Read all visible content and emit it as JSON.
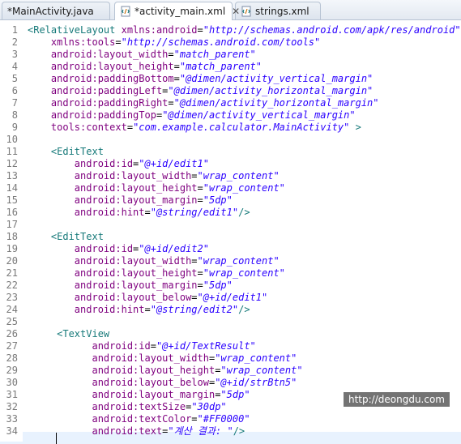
{
  "tabs": [
    {
      "label": "*MainActivity.java",
      "icon": "java-file-icon",
      "active": false
    },
    {
      "label": "*activity_main.xml",
      "icon": "xml-file-icon",
      "active": true,
      "close": "✕"
    },
    {
      "label": "strings.xml",
      "icon": "xml-file-icon",
      "active": false
    }
  ],
  "code_lines": [
    {
      "n": "1",
      "tok": [
        [
          "tag",
          "<RelativeLayout "
        ],
        [
          "attr",
          "xmlns:android"
        ],
        [
          "eq",
          "="
        ],
        [
          "val",
          "\"http://schemas.android.com/apk/res/android\""
        ]
      ]
    },
    {
      "n": "2",
      "tok": [
        [
          "attr",
          "    xmlns:tools"
        ],
        [
          "eq",
          "="
        ],
        [
          "val",
          "\"http://schemas.android.com/tools\""
        ]
      ]
    },
    {
      "n": "3",
      "tok": [
        [
          "attr",
          "    android:layout_width"
        ],
        [
          "eq",
          "="
        ],
        [
          "val",
          "\"match_parent\""
        ]
      ]
    },
    {
      "n": "4",
      "tok": [
        [
          "attr",
          "    android:layout_height"
        ],
        [
          "eq",
          "="
        ],
        [
          "val",
          "\"match_parent\""
        ]
      ]
    },
    {
      "n": "5",
      "tok": [
        [
          "attr",
          "    android:paddingBottom"
        ],
        [
          "eq",
          "="
        ],
        [
          "val",
          "\"@dimen/activity_vertical_margin\""
        ]
      ]
    },
    {
      "n": "6",
      "tok": [
        [
          "attr",
          "    android:paddingLeft"
        ],
        [
          "eq",
          "="
        ],
        [
          "val",
          "\"@dimen/activity_horizontal_margin\""
        ]
      ]
    },
    {
      "n": "7",
      "tok": [
        [
          "attr",
          "    android:paddingRight"
        ],
        [
          "eq",
          "="
        ],
        [
          "val",
          "\"@dimen/activity_horizontal_margin\""
        ]
      ]
    },
    {
      "n": "8",
      "tok": [
        [
          "attr",
          "    android:paddingTop"
        ],
        [
          "eq",
          "="
        ],
        [
          "val",
          "\"@dimen/activity_vertical_margin\""
        ]
      ]
    },
    {
      "n": "9",
      "tok": [
        [
          "attr",
          "    tools:context"
        ],
        [
          "eq",
          "="
        ],
        [
          "val",
          "\"com.example.calculator.MainActivity\""
        ],
        [
          "tag",
          " >"
        ]
      ]
    },
    {
      "n": "10",
      "tok": []
    },
    {
      "n": "11",
      "tok": [
        [
          "tag",
          "    <EditText"
        ]
      ]
    },
    {
      "n": "12",
      "tok": [
        [
          "attr",
          "        android:id"
        ],
        [
          "eq",
          "="
        ],
        [
          "val",
          "\"@+id/edit1\""
        ]
      ]
    },
    {
      "n": "13",
      "tok": [
        [
          "attr",
          "        android:layout_width"
        ],
        [
          "eq",
          "="
        ],
        [
          "val",
          "\"wrap_content\""
        ]
      ]
    },
    {
      "n": "14",
      "tok": [
        [
          "attr",
          "        android:layout_height"
        ],
        [
          "eq",
          "="
        ],
        [
          "val",
          "\"wrap_content\""
        ]
      ]
    },
    {
      "n": "15",
      "tok": [
        [
          "attr",
          "        android:layout_margin"
        ],
        [
          "eq",
          "="
        ],
        [
          "val",
          "\"5dp\""
        ]
      ]
    },
    {
      "n": "16",
      "tok": [
        [
          "attr",
          "        android:hint"
        ],
        [
          "eq",
          "="
        ],
        [
          "val",
          "\"@string/edit1\""
        ],
        [
          "tag",
          "/>"
        ]
      ]
    },
    {
      "n": "17",
      "tok": []
    },
    {
      "n": "18",
      "tok": [
        [
          "tag",
          "    <EditText"
        ]
      ]
    },
    {
      "n": "19",
      "tok": [
        [
          "attr",
          "        android:id"
        ],
        [
          "eq",
          "="
        ],
        [
          "val",
          "\"@+id/edit2\""
        ]
      ]
    },
    {
      "n": "20",
      "tok": [
        [
          "attr",
          "        android:layout_width"
        ],
        [
          "eq",
          "="
        ],
        [
          "val",
          "\"wrap_content\""
        ]
      ]
    },
    {
      "n": "21",
      "tok": [
        [
          "attr",
          "        android:layout_height"
        ],
        [
          "eq",
          "="
        ],
        [
          "val",
          "\"wrap_content\""
        ]
      ]
    },
    {
      "n": "22",
      "tok": [
        [
          "attr",
          "        android:layout_margin"
        ],
        [
          "eq",
          "="
        ],
        [
          "val",
          "\"5dp\""
        ]
      ]
    },
    {
      "n": "23",
      "tok": [
        [
          "attr",
          "        android:layout_below"
        ],
        [
          "eq",
          "="
        ],
        [
          "val",
          "\"@+id/edit1\""
        ]
      ]
    },
    {
      "n": "24",
      "tok": [
        [
          "attr",
          "        android:hint"
        ],
        [
          "eq",
          "="
        ],
        [
          "val",
          "\"@string/edit2\""
        ],
        [
          "tag",
          "/>"
        ]
      ]
    },
    {
      "n": "25",
      "tok": []
    },
    {
      "n": "26",
      "tok": [
        [
          "tag",
          "     <TextView"
        ]
      ]
    },
    {
      "n": "27",
      "tok": [
        [
          "attr",
          "           android:id"
        ],
        [
          "eq",
          "="
        ],
        [
          "val",
          "\"@+id/TextResult\""
        ]
      ]
    },
    {
      "n": "28",
      "tok": [
        [
          "attr",
          "           android:layout_width"
        ],
        [
          "eq",
          "="
        ],
        [
          "val",
          "\"wrap_content\""
        ]
      ]
    },
    {
      "n": "29",
      "tok": [
        [
          "attr",
          "           android:layout_height"
        ],
        [
          "eq",
          "="
        ],
        [
          "val",
          "\"wrap_content\""
        ]
      ]
    },
    {
      "n": "30",
      "tok": [
        [
          "attr",
          "           android:layout_below"
        ],
        [
          "eq",
          "="
        ],
        [
          "val",
          "\"@+id/strBtn5\""
        ]
      ]
    },
    {
      "n": "31",
      "tok": [
        [
          "attr",
          "           android:layout_margin"
        ],
        [
          "eq",
          "="
        ],
        [
          "val",
          "\"5dp\""
        ]
      ]
    },
    {
      "n": "32",
      "tok": [
        [
          "attr",
          "           android:textSize"
        ],
        [
          "eq",
          "="
        ],
        [
          "val",
          "\"30dp\""
        ]
      ]
    },
    {
      "n": "33",
      "tok": [
        [
          "attr",
          "           android:textColor"
        ],
        [
          "eq",
          "="
        ],
        [
          "val",
          "\"#FF0000\""
        ]
      ]
    },
    {
      "n": "34",
      "tok": [
        [
          "attr",
          "           android:text"
        ],
        [
          "eq",
          "="
        ],
        [
          "val",
          "\"계산 결과: \""
        ],
        [
          "tag",
          "/>"
        ]
      ]
    }
  ],
  "watermark": "http://deongdu.com",
  "colors": {
    "tag": "#177a7a",
    "attr": "#7f007f",
    "value": "#2a00ff",
    "line_number": "#7a7a7a"
  }
}
